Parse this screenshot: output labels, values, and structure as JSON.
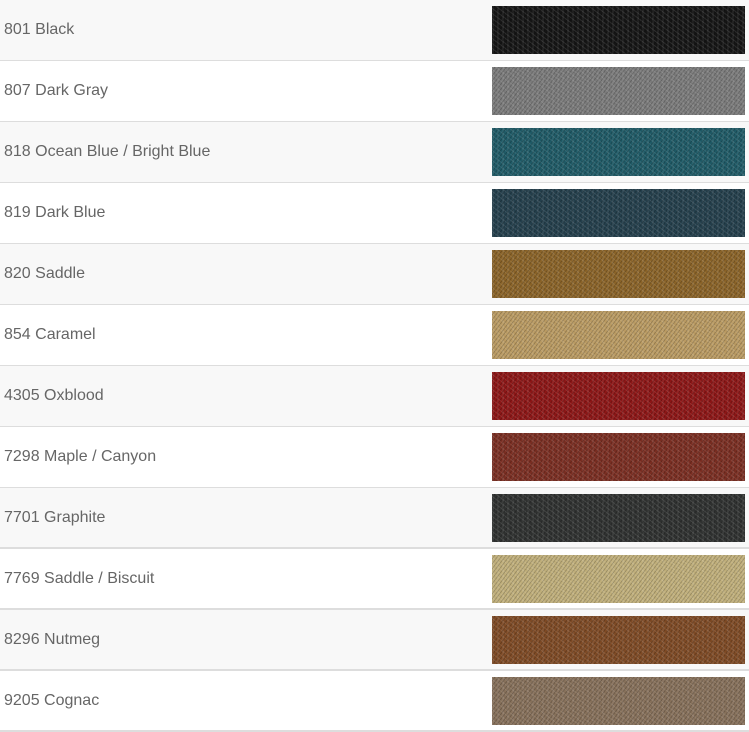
{
  "colors": [
    {
      "label": "801 Black",
      "swatch": "#151515"
    },
    {
      "label": "807 Dark Gray",
      "swatch": "#7a7a7a"
    },
    {
      "label": "818 Ocean Blue / Bright Blue",
      "swatch": "#1f5a66"
    },
    {
      "label": "819 Dark Blue",
      "swatch": "#243f4c"
    },
    {
      "label": "820 Saddle",
      "swatch": "#8a6328"
    },
    {
      "label": "854 Caramel",
      "swatch": "#b99a62"
    },
    {
      "label": "4305 Oxblood",
      "swatch": "#8c1616"
    },
    {
      "label": "7298 Maple / Canyon",
      "swatch": "#7a2e22"
    },
    {
      "label": "7701 Graphite",
      "swatch": "#2f3130"
    },
    {
      "label": "7769 Saddle / Biscuit",
      "swatch": "#bfae7a"
    },
    {
      "label": "8296 Nutmeg",
      "swatch": "#7e4a25"
    },
    {
      "label": "9205 Cognac",
      "swatch": "#86705a"
    }
  ]
}
